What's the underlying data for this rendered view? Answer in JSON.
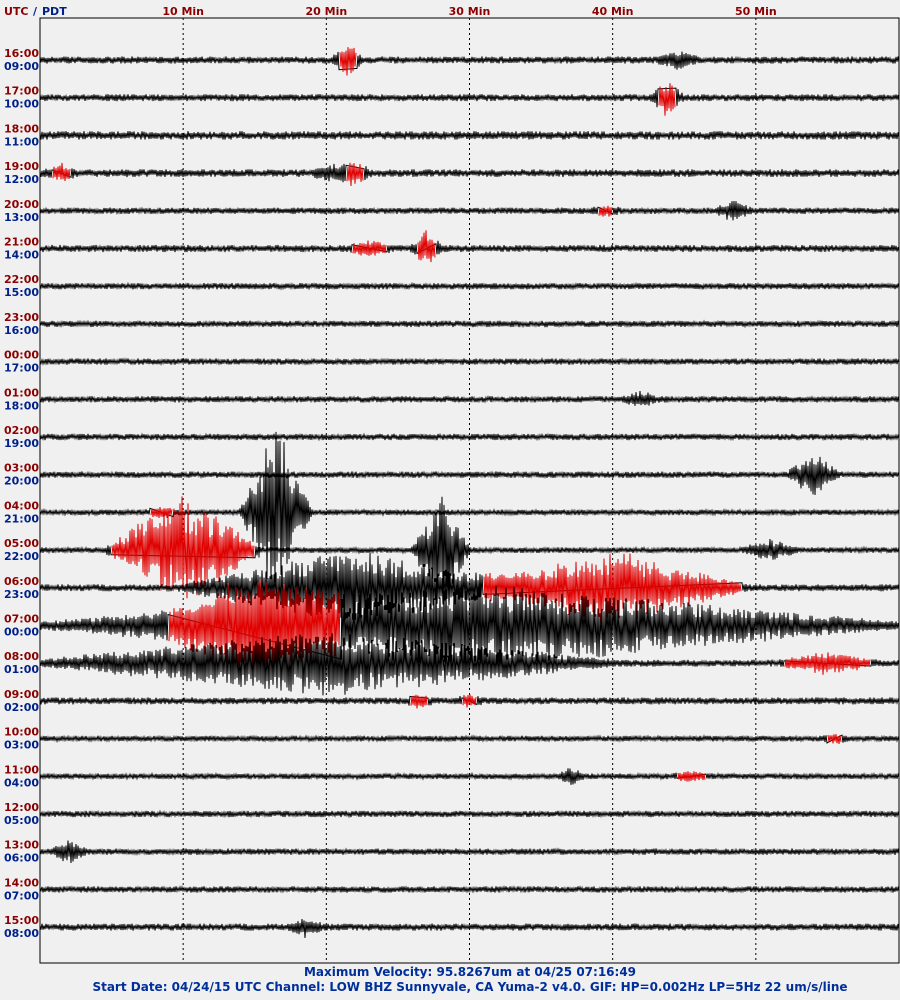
{
  "header": {
    "utc_label": "UTC",
    "separator": "/",
    "pdt_label": "PDT"
  },
  "colors": {
    "background": "#f0f0f0",
    "trace": "#000000",
    "highlight": "#e00000",
    "utc_text": "#8b0000",
    "pdt_text": "#00208a",
    "footer_text": "#002f9a"
  },
  "footer": {
    "line1": "Maximum Velocity: 95.8267um at 04/25 07:16:49",
    "line2": "Start Date: 04/24/15 UTC Channel: LOW  BHZ  Sunnyvale, CA  Yuma-2 v4.0. GIF: HP=0.002Hz LP=5Hz 22 um/s/line"
  },
  "chart_data": {
    "type": "line",
    "subtype": "helicorder",
    "x_unit": "minutes past hour",
    "xlim": [
      0,
      60
    ],
    "x_ticks": [
      {
        "value": 10,
        "label": "10 Min"
      },
      {
        "value": 20,
        "label": "20 Min"
      },
      {
        "value": 30,
        "label": "30 Min"
      },
      {
        "value": 40,
        "label": "40 Min"
      },
      {
        "value": 50,
        "label": "50 Min"
      }
    ],
    "gridlines": "vertical dotted at 10-minute intervals",
    "rows": [
      {
        "utc": "16:00",
        "pdt": "09:00",
        "noise": 1.0,
        "events": [
          {
            "t": 21.5,
            "amp": 3.5,
            "dur": 1.2,
            "red": true
          },
          {
            "t": 44.5,
            "amp": 1.8,
            "dur": 2.0,
            "red": false
          }
        ]
      },
      {
        "utc": "17:00",
        "pdt": "10:00",
        "noise": 1.0,
        "events": [
          {
            "t": 43.8,
            "amp": 4.0,
            "dur": 1.2,
            "red": true
          }
        ]
      },
      {
        "utc": "18:00",
        "pdt": "11:00",
        "noise": 1.2,
        "events": []
      },
      {
        "utc": "19:00",
        "pdt": "12:00",
        "noise": 1.1,
        "events": [
          {
            "t": 1.5,
            "amp": 1.5,
            "dur": 1.2,
            "red": true
          },
          {
            "t": 22.0,
            "amp": 2.4,
            "dur": 1.2,
            "red": true
          },
          {
            "t": 20.5,
            "amp": 2.0,
            "dur": 2.0,
            "red": false
          }
        ]
      },
      {
        "utc": "20:00",
        "pdt": "13:00",
        "noise": 0.9,
        "events": [
          {
            "t": 39.5,
            "amp": 1.0,
            "dur": 1.0,
            "red": true
          },
          {
            "t": 48.5,
            "amp": 2.2,
            "dur": 1.5,
            "red": false
          }
        ]
      },
      {
        "utc": "21:00",
        "pdt": "14:00",
        "noise": 1.0,
        "events": [
          {
            "t": 23.0,
            "amp": 1.6,
            "dur": 2.4,
            "red": true
          },
          {
            "t": 27.0,
            "amp": 3.5,
            "dur": 1.2,
            "red": true
          }
        ]
      },
      {
        "utc": "22:00",
        "pdt": "15:00",
        "noise": 0.9,
        "events": []
      },
      {
        "utc": "23:00",
        "pdt": "16:00",
        "noise": 0.9,
        "events": []
      },
      {
        "utc": "00:00",
        "pdt": "17:00",
        "noise": 0.9,
        "events": []
      },
      {
        "utc": "01:00",
        "pdt": "18:00",
        "noise": 0.9,
        "events": [
          {
            "t": 42.0,
            "amp": 1.5,
            "dur": 1.5,
            "red": false
          }
        ]
      },
      {
        "utc": "02:00",
        "pdt": "19:00",
        "noise": 0.9,
        "events": []
      },
      {
        "utc": "03:00",
        "pdt": "20:00",
        "noise": 0.9,
        "events": [
          {
            "t": 54.0,
            "amp": 5.0,
            "dur": 2.5,
            "red": false
          }
        ]
      },
      {
        "utc": "04:00",
        "pdt": "21:00",
        "noise": 0.8,
        "events": [
          {
            "t": 8.5,
            "amp": 1.0,
            "dur": 1.5,
            "red": true
          },
          {
            "t": 16.5,
            "amp": 20,
            "dur": 4.0,
            "red": false
          }
        ]
      },
      {
        "utc": "05:00",
        "pdt": "22:00",
        "noise": 0.8,
        "events": [
          {
            "t": 51.0,
            "amp": 2.2,
            "dur": 3.0,
            "red": false
          },
          {
            "t": 10,
            "amp": 12,
            "dur": 10,
            "red": true
          },
          {
            "t": 28.0,
            "amp": 12,
            "dur": 3.0,
            "red": false
          }
        ]
      },
      {
        "utc": "06:00",
        "pdt": "23:00",
        "noise": 1.0,
        "events": [
          {
            "t": 22,
            "amp": 8,
            "dur": 24,
            "red": false
          },
          {
            "t": 40,
            "amp": 8,
            "dur": 18,
            "red": true
          }
        ]
      },
      {
        "utc": "07:00",
        "pdt": "00:00",
        "noise": 1.0,
        "events": [
          {
            "t": 30,
            "amp": 9,
            "dur": 60,
            "red": false
          },
          {
            "t": 15,
            "amp": 7,
            "dur": 12,
            "red": true
          }
        ]
      },
      {
        "utc": "08:00",
        "pdt": "01:00",
        "noise": 1.0,
        "events": [
          {
            "t": 20,
            "amp": 7,
            "dur": 40,
            "red": false
          },
          {
            "t": 55,
            "amp": 2,
            "dur": 6,
            "red": true
          }
        ]
      },
      {
        "utc": "09:00",
        "pdt": "02:00",
        "noise": 1.0,
        "events": [
          {
            "t": 26.5,
            "amp": 1.2,
            "dur": 1.2,
            "red": true
          },
          {
            "t": 30.0,
            "amp": 1.0,
            "dur": 1.0,
            "red": true
          }
        ]
      },
      {
        "utc": "10:00",
        "pdt": "03:00",
        "noise": 0.8,
        "events": [
          {
            "t": 55.5,
            "amp": 0.9,
            "dur": 1.0,
            "red": true
          }
        ]
      },
      {
        "utc": "11:00",
        "pdt": "04:00",
        "noise": 0.8,
        "events": [
          {
            "t": 45.5,
            "amp": 0.9,
            "dur": 2.0,
            "red": true
          },
          {
            "t": 37.0,
            "amp": 1.8,
            "dur": 1.0,
            "red": false
          }
        ]
      },
      {
        "utc": "12:00",
        "pdt": "05:00",
        "noise": 0.9,
        "events": []
      },
      {
        "utc": "13:00",
        "pdt": "06:00",
        "noise": 0.9,
        "events": [
          {
            "t": 2.0,
            "amp": 2.5,
            "dur": 1.5,
            "red": false
          }
        ]
      },
      {
        "utc": "14:00",
        "pdt": "07:00",
        "noise": 0.9,
        "events": []
      },
      {
        "utc": "15:00",
        "pdt": "08:00",
        "noise": 1.0,
        "events": [
          {
            "t": 18.5,
            "amp": 1.8,
            "dur": 1.5,
            "red": false
          }
        ]
      }
    ]
  }
}
